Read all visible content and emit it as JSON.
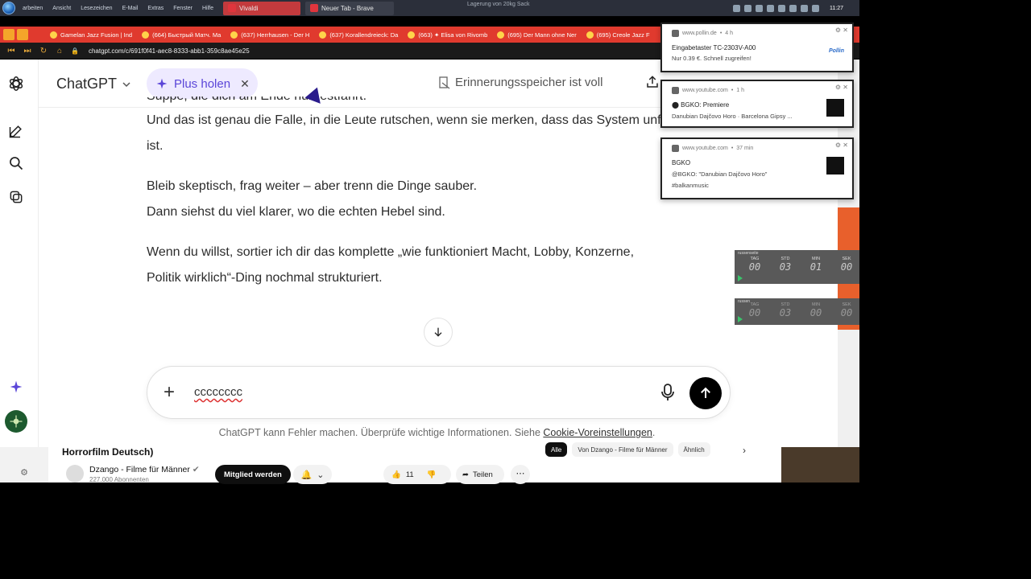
{
  "taskbar": {
    "menus": [
      "arbeiten",
      "Ansicht",
      "Lesezeichen",
      "E-Mail",
      "Extras",
      "Fenster",
      "Hilfe"
    ],
    "tasks": [
      {
        "label": "Vivaldi",
        "color": "#c33a3d"
      },
      {
        "label": "Neuer Tab - Brave",
        "color": "#3b3f4b"
      }
    ],
    "center_text": "Lagerung von 20kg Sack",
    "clock": "11:27"
  },
  "browser_tabs": [
    "Gamelan Jazz Fusion | Ind",
    "(664) Быстрый Матч. Ma",
    "(637) Herrhausen - Der H",
    "(637) Korallendreieck: Da",
    "(663) ✦ Elisa von Rivomb",
    "(695) Der Mann ohne Ner",
    "(695) Creole Jazz F"
  ],
  "address": {
    "url": "chatgpt.com/c/691f0f41-aec8-8333-abb1-359c8ae45e25"
  },
  "chatgpt": {
    "brand": "ChatGPT",
    "plus_label": "Plus holen",
    "memory_label": "Erinnerungsspeicher ist voll",
    "clipped_line": "Suppe, die dich am Ende nur festfährt.",
    "paragraphs": [
      {
        "line1": "Und das ist genau die Falle, in die Leute rutschen, wenn sie merken, dass das System unfair",
        "line2": "ist."
      },
      {
        "line1": "Bleib skeptisch, frag weiter – aber trenn die Dinge sauber.",
        "line2": "Dann siehst du viel klarer, wo die echten Hebel sind."
      },
      {
        "line1": "Wenn du willst, sortier ich dir das komplette „wie funktioniert Macht, Lobby, Konzerne,",
        "line2": "Politik wirklich“-Ding nochmal strukturiert."
      }
    ],
    "composer_value": "cccccccc",
    "disclaimer_text": "ChatGPT kann Fehler machen. Überprüfe wichtige Informationen. Siehe ",
    "disclaimer_link": "Cookie-Voreinstellungen",
    "disclaimer_end": ".",
    "accent": "#5b46d8"
  },
  "youtube": {
    "title": "Horrorfilm Deutsch)",
    "channel": "Dzango - Filme für Männer",
    "subscribers": "227.000 Abonnenten",
    "member_button": "Mitglied werden",
    "likes": "11",
    "share": "Teilen",
    "chips": [
      "Alle",
      "Von Dzango - Filme für Männer",
      "Ähnlich"
    ]
  },
  "notifications": [
    {
      "source": "www.pollin.de",
      "age": "4 h",
      "title": "Eingabetaster TC-2303V-A00",
      "body": "Nur 0.39 €. Schnell zugreifen!",
      "brand": "Pollin"
    },
    {
      "source": "www.youtube.com",
      "age": "1 h",
      "title": "⬤ BGKO: Premiere",
      "body": "Danubian Dajčovo Horo · Barcelona Gipsy ..."
    },
    {
      "source": "www.youtube.com",
      "age": "37 min",
      "title": "BGKO",
      "body": "@BGKO: \"Danubian Dajčovo Horo\"",
      "body2": "#balkanmusic"
    }
  ],
  "timers": [
    {
      "header": "russenseite",
      "labels": [
        "TAG",
        "STD",
        "MIN",
        "SEK"
      ],
      "values": [
        "00",
        "03",
        "01",
        "00"
      ]
    },
    {
      "header": "russen",
      "labels": [
        "TAG",
        "STD",
        "MIN",
        "SEK"
      ],
      "values": [
        "00",
        "03",
        "00",
        "00"
      ]
    }
  ]
}
